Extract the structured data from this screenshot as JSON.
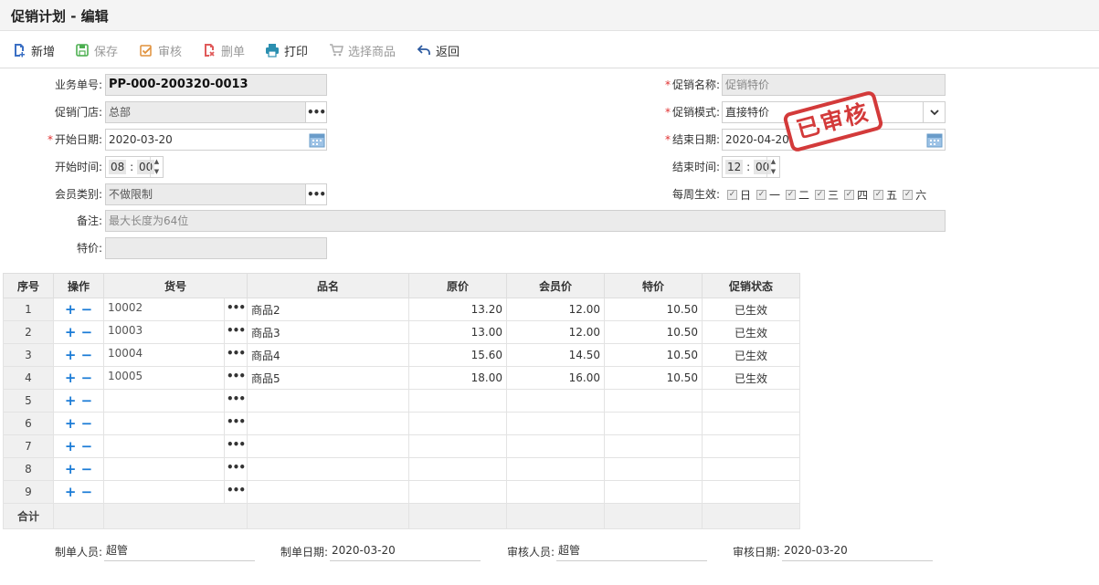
{
  "window": {
    "title": "促销计划 - 编辑"
  },
  "toolbar": {
    "new": "新增",
    "save": "保存",
    "audit": "审核",
    "delete": "删单",
    "print": "打印",
    "select_goods": "选择商品",
    "back": "返回"
  },
  "form": {
    "bill_no_label": "业务单号:",
    "bill_no": "PP-000-200320-0013",
    "store_label": "促销门店:",
    "store": "总部",
    "start_date_label": "开始日期:",
    "start_date": "2020-03-20",
    "start_time_label": "开始时间:",
    "start_hh": "08",
    "start_mm": "00",
    "member_type_label": "会员类别:",
    "member_type": "不做限制",
    "remark_label": "备注:",
    "remark_placeholder": "最大长度为64位",
    "special_price_label": "特价:",
    "promo_name_label": "促销名称:",
    "promo_name_placeholder": "促销特价",
    "promo_mode_label": "促销模式:",
    "promo_mode": "直接特价",
    "end_date_label": "结束日期:",
    "end_date": "2020-04-20",
    "end_time_label": "结束时间:",
    "end_hh": "12",
    "end_mm": "00",
    "weekly_label": "每周生效:",
    "weekdays": [
      "日",
      "一",
      "二",
      "三",
      "四",
      "五",
      "六"
    ],
    "stamp": "已审核"
  },
  "grid": {
    "headers": {
      "seq": "序号",
      "ops": "操作",
      "code": "货号",
      "name": "品名",
      "price": "原价",
      "member_price": "会员价",
      "special": "特价",
      "status": "促销状态"
    },
    "ops_symbol": "+ −",
    "more_symbol": "•••",
    "rows": [
      {
        "seq": "1",
        "code": "10002",
        "name": "商品2",
        "price": "13.20",
        "member_price": "12.00",
        "special": "10.50",
        "status": "已生效"
      },
      {
        "seq": "2",
        "code": "10003",
        "name": "商品3",
        "price": "13.00",
        "member_price": "12.00",
        "special": "10.50",
        "status": "已生效"
      },
      {
        "seq": "3",
        "code": "10004",
        "name": "商品4",
        "price": "15.60",
        "member_price": "14.50",
        "special": "10.50",
        "status": "已生效"
      },
      {
        "seq": "4",
        "code": "10005",
        "name": "商品5",
        "price": "18.00",
        "member_price": "16.00",
        "special": "10.50",
        "status": "已生效"
      },
      {
        "seq": "5",
        "code": "",
        "name": "",
        "price": "",
        "member_price": "",
        "special": "",
        "status": ""
      },
      {
        "seq": "6",
        "code": "",
        "name": "",
        "price": "",
        "member_price": "",
        "special": "",
        "status": ""
      },
      {
        "seq": "7",
        "code": "",
        "name": "",
        "price": "",
        "member_price": "",
        "special": "",
        "status": ""
      },
      {
        "seq": "8",
        "code": "",
        "name": "",
        "price": "",
        "member_price": "",
        "special": "",
        "status": ""
      },
      {
        "seq": "9",
        "code": "",
        "name": "",
        "price": "",
        "member_price": "",
        "special": "",
        "status": ""
      }
    ],
    "total_label": "合计"
  },
  "footer": {
    "maker_label": "制单人员:",
    "maker": "超管",
    "make_date_label": "制单日期:",
    "make_date": "2020-03-20",
    "auditor_label": "审核人员:",
    "auditor": "超管",
    "audit_date_label": "审核日期:",
    "audit_date": "2020-03-20"
  },
  "colors": {
    "accent": "#1a7bd6",
    "stamp": "#d33a3a",
    "required": "#e03030"
  }
}
